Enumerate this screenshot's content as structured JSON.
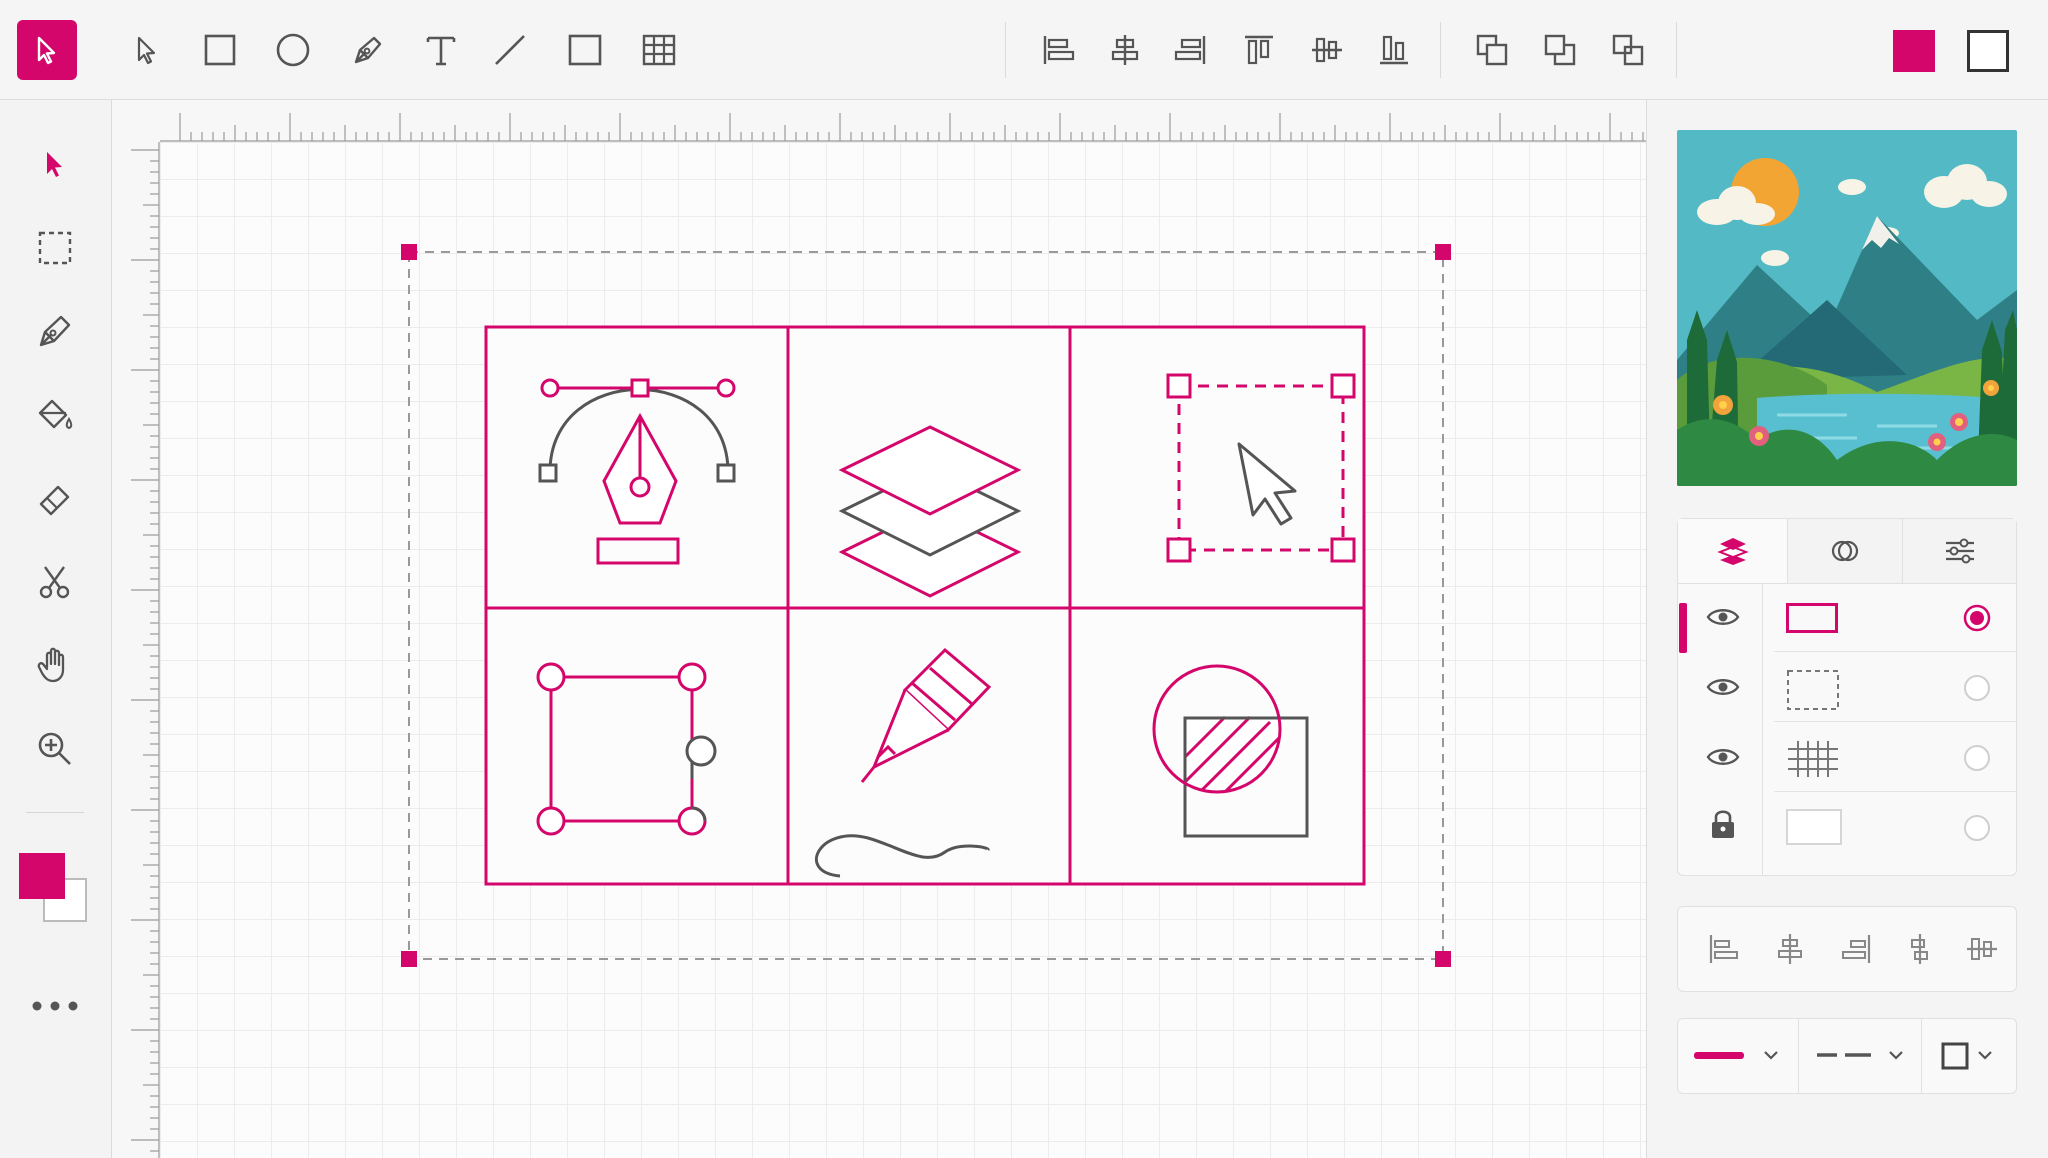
{
  "toolbar": {
    "tools": [
      {
        "name": "select-tool",
        "icon": "arrow-pointer-icon",
        "active": true
      },
      {
        "name": "direct-select-tool",
        "icon": "cursor-outline-icon"
      },
      {
        "name": "rectangle-tool",
        "icon": "rectangle-icon"
      },
      {
        "name": "ellipse-tool",
        "icon": "ellipse-icon"
      },
      {
        "name": "pen-tool",
        "icon": "pen-nib-icon"
      },
      {
        "name": "text-tool",
        "icon": "text-icon"
      },
      {
        "name": "line-tool",
        "icon": "line-icon"
      },
      {
        "name": "frame-tool",
        "icon": "frame-icon"
      },
      {
        "name": "table-tool",
        "icon": "grid-icon"
      }
    ],
    "align_tools": [
      "align-left-icon",
      "align-center-icon",
      "align-right-icon",
      "align-top-icon",
      "align-middle-icon",
      "align-bottom-icon"
    ],
    "arrange_tools": [
      "bring-forward-icon",
      "send-backward-icon",
      "group-icon"
    ],
    "fill_color": "#d4066b",
    "stroke_color": "#ffffff"
  },
  "left_tools": [
    "arrow-select-icon",
    "marquee-select-icon",
    "pen-nib-icon",
    "paint-bucket-icon",
    "eraser-icon",
    "scissors-icon",
    "hand-icon",
    "zoom-in-icon"
  ],
  "colors": {
    "accent": "#d4066b",
    "icon_gray": "#555555"
  },
  "artwork_cells": [
    "pen-tool-bezier-icon",
    "layers-icon",
    "selection-cursor-icon",
    "rectangle-anchor-points-icon",
    "pencil-draw-icon",
    "shape-intersect-icon"
  ],
  "panel": {
    "preview": "landscape-thumbnail",
    "tabs": [
      {
        "icon": "layers-tab-icon",
        "active": true
      },
      {
        "icon": "blend-tab-icon"
      },
      {
        "icon": "adjustments-tab-icon"
      }
    ],
    "layers": [
      {
        "visibility_icon": "eye-icon",
        "thumb": "solid-rect",
        "selected": true
      },
      {
        "visibility_icon": "eye-icon",
        "thumb": "dashed-rect",
        "selected": false
      },
      {
        "visibility_icon": "eye-icon",
        "thumb": "grid",
        "selected": false
      },
      {
        "visibility_icon": "lock-icon",
        "thumb": "empty-rect",
        "selected": false
      }
    ],
    "align_row": [
      "align-left-icon",
      "align-center-icon",
      "align-right-icon",
      "distribute-horizontal-icon",
      "distribute-vertical-icon"
    ],
    "stroke_controls": [
      "stroke-color-dropdown",
      "stroke-dash-dropdown",
      "stroke-style-dropdown"
    ]
  }
}
